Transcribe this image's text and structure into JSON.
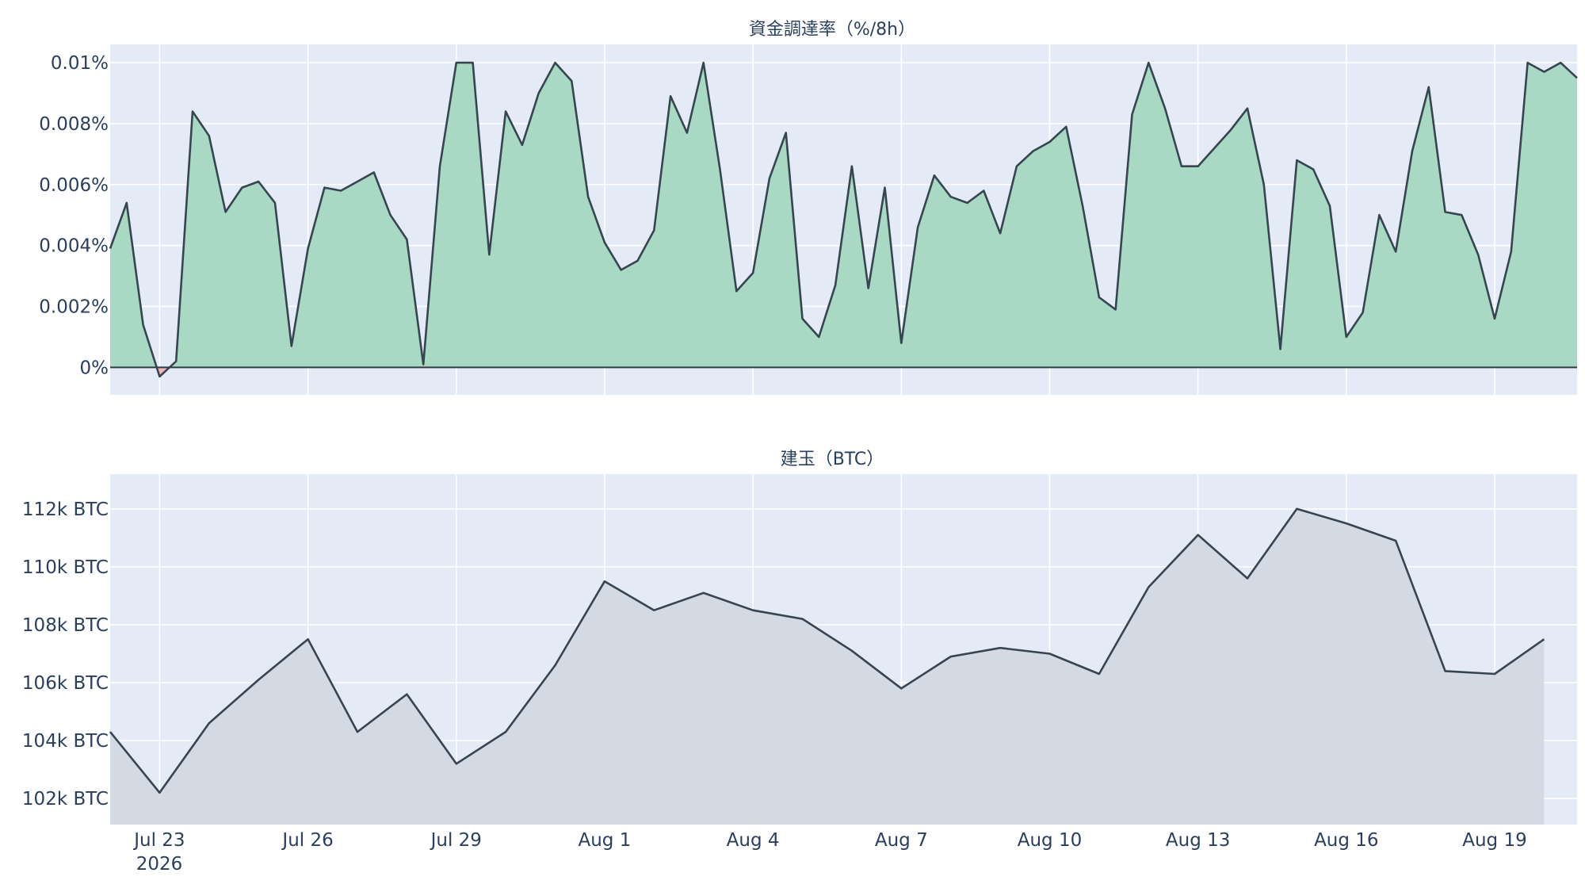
{
  "chart_data": [
    {
      "type": "area",
      "title": "資金調達率（%/8h）",
      "ylim": [
        -0.0009,
        0.0106
      ],
      "yticks": [
        0,
        0.002,
        0.004,
        0.006,
        0.008,
        0.01
      ],
      "ytick_labels": [
        "0%",
        "0.002%",
        "0.004%",
        "0.006%",
        "0.008%",
        "0.01%"
      ],
      "xlim": [
        "2026-07-22T00:00",
        "2026-08-20T16:00"
      ],
      "grid": true,
      "positive_fill": "#a9d8c5",
      "negative_fill": "#f4b6b6",
      "line_color": "#36454f",
      "series": [
        {
          "x": [
            "2026-07-22T00:00",
            "2026-07-22T08:00",
            "2026-07-22T16:00",
            "2026-07-23T00:00",
            "2026-07-23T08:00",
            "2026-07-23T16:00",
            "2026-07-24T00:00",
            "2026-07-24T08:00",
            "2026-07-24T16:00",
            "2026-07-25T00:00",
            "2026-07-25T08:00",
            "2026-07-25T16:00",
            "2026-07-26T00:00",
            "2026-07-26T08:00",
            "2026-07-26T16:00",
            "2026-07-27T00:00",
            "2026-07-27T08:00",
            "2026-07-27T16:00",
            "2026-07-28T00:00",
            "2026-07-28T08:00",
            "2026-07-28T16:00",
            "2026-07-29T00:00",
            "2026-07-29T08:00",
            "2026-07-29T16:00",
            "2026-07-30T00:00",
            "2026-07-30T08:00",
            "2026-07-30T16:00",
            "2026-07-31T00:00",
            "2026-07-31T08:00",
            "2026-07-31T16:00",
            "2026-08-01T00:00",
            "2026-08-01T08:00",
            "2026-08-01T16:00",
            "2026-08-02T00:00",
            "2026-08-02T08:00",
            "2026-08-02T16:00",
            "2026-08-03T00:00",
            "2026-08-03T08:00",
            "2026-08-03T16:00",
            "2026-08-04T00:00",
            "2026-08-04T08:00",
            "2026-08-04T16:00",
            "2026-08-05T00:00",
            "2026-08-05T08:00",
            "2026-08-05T16:00",
            "2026-08-06T00:00",
            "2026-08-06T08:00",
            "2026-08-06T16:00",
            "2026-08-07T00:00",
            "2026-08-07T08:00",
            "2026-08-07T16:00",
            "2026-08-08T00:00",
            "2026-08-08T08:00",
            "2026-08-08T16:00",
            "2026-08-09T00:00",
            "2026-08-09T08:00",
            "2026-08-09T16:00",
            "2026-08-10T00:00",
            "2026-08-10T08:00",
            "2026-08-10T16:00",
            "2026-08-11T00:00",
            "2026-08-11T08:00",
            "2026-08-11T16:00",
            "2026-08-12T00:00",
            "2026-08-12T08:00",
            "2026-08-12T16:00",
            "2026-08-13T00:00",
            "2026-08-13T08:00",
            "2026-08-13T16:00",
            "2026-08-14T00:00",
            "2026-08-14T08:00",
            "2026-08-14T16:00",
            "2026-08-15T00:00",
            "2026-08-15T08:00",
            "2026-08-15T16:00",
            "2026-08-16T00:00",
            "2026-08-16T08:00",
            "2026-08-16T16:00",
            "2026-08-17T00:00",
            "2026-08-17T08:00",
            "2026-08-17T16:00",
            "2026-08-18T00:00",
            "2026-08-18T08:00",
            "2026-08-18T16:00",
            "2026-08-19T00:00",
            "2026-08-19T08:00",
            "2026-08-19T16:00",
            "2026-08-20T00:00",
            "2026-08-20T08:00",
            "2026-08-20T16:00"
          ],
          "y": [
            0.0039,
            0.0054,
            0.0014,
            -0.0003,
            0.0002,
            0.0084,
            0.0076,
            0.0051,
            0.0059,
            0.0061,
            0.0054,
            0.0007,
            0.0039,
            0.0059,
            0.0058,
            0.0061,
            0.0064,
            0.005,
            0.0042,
            0.0001,
            0.0066,
            0.01,
            0.01,
            0.0037,
            0.0084,
            0.0073,
            0.009,
            0.01,
            0.0094,
            0.0056,
            0.0041,
            0.0032,
            0.0035,
            0.0045,
            0.0089,
            0.0077,
            0.01,
            0.0065,
            0.0025,
            0.0031,
            0.0062,
            0.0077,
            0.0016,
            0.001,
            0.0027,
            0.0066,
            0.0026,
            0.0059,
            0.0008,
            0.0046,
            0.0063,
            0.0056,
            0.0054,
            0.0058,
            0.0044,
            0.0066,
            0.0071,
            0.0074,
            0.0079,
            0.0053,
            0.0023,
            0.0019,
            0.0083,
            0.01,
            0.0085,
            0.0066,
            0.0066,
            0.0072,
            0.0078,
            0.0085,
            0.006,
            0.0006,
            0.0068,
            0.0065,
            0.0053,
            0.001,
            0.0018,
            0.005,
            0.0038,
            0.0071,
            0.0092,
            0.0051,
            0.005,
            0.0037,
            0.0016,
            0.0038,
            0.01,
            0.0097,
            0.01,
            0.0095
          ]
        }
      ]
    },
    {
      "type": "area",
      "title": "建玉（BTC）",
      "ylim": [
        101100,
        113200
      ],
      "yticks": [
        102000,
        104000,
        106000,
        108000,
        110000,
        112000
      ],
      "ytick_labels": [
        "102k BTC",
        "104k BTC",
        "106k BTC",
        "108k BTC",
        "110k BTC",
        "112k BTC"
      ],
      "xlim": [
        "2026-07-22T00:00",
        "2026-08-20T16:00"
      ],
      "grid": true,
      "fill": "#d3dae3",
      "line_color": "#36454f",
      "series": [
        {
          "x": [
            "2026-07-22",
            "2026-07-23",
            "2026-07-24",
            "2026-07-25",
            "2026-07-26",
            "2026-07-27",
            "2026-07-28",
            "2026-07-29",
            "2026-07-30",
            "2026-07-31",
            "2026-08-01",
            "2026-08-02",
            "2026-08-03",
            "2026-08-04",
            "2026-08-05",
            "2026-08-06",
            "2026-08-07",
            "2026-08-08",
            "2026-08-09",
            "2026-08-10",
            "2026-08-11",
            "2026-08-12",
            "2026-08-13",
            "2026-08-14",
            "2026-08-15",
            "2026-08-16",
            "2026-08-17",
            "2026-08-18",
            "2026-08-19",
            "2026-08-20"
          ],
          "y": [
            104300,
            102200,
            104600,
            106100,
            107500,
            104300,
            105600,
            103200,
            104300,
            106600,
            109500,
            108500,
            109100,
            108500,
            108200,
            107100,
            105800,
            106900,
            107200,
            107000,
            106300,
            109300,
            111100,
            109600,
            112000,
            111500,
            110900,
            106400,
            106300,
            107500
          ]
        }
      ]
    }
  ],
  "x_axis": {
    "ticks": [
      "2026-07-23",
      "2026-07-26",
      "2026-07-29",
      "2026-08-01",
      "2026-08-04",
      "2026-08-07",
      "2026-08-10",
      "2026-08-13",
      "2026-08-16",
      "2026-08-19"
    ],
    "tick_labels": [
      "Jul 23",
      "Jul 26",
      "Jul 29",
      "Aug 1",
      "Aug 4",
      "Aug 7",
      "Aug 10",
      "Aug 13",
      "Aug 16",
      "Aug 19"
    ],
    "year_label": "2026"
  }
}
